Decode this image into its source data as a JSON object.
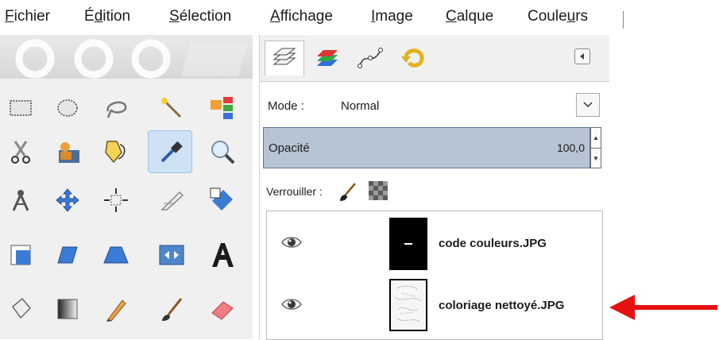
{
  "menubar": {
    "items": [
      {
        "before": "",
        "u": "F",
        "after": "ichier"
      },
      {
        "before": "É",
        "u": "d",
        "after": "ition"
      },
      {
        "before": "",
        "u": "S",
        "after": "élection"
      },
      {
        "before": "",
        "u": "A",
        "after": "ffichage"
      },
      {
        "before": "",
        "u": "I",
        "after": "mage"
      },
      {
        "before": "",
        "u": "C",
        "after": "alque"
      },
      {
        "before": "Coule",
        "u": "u",
        "after": "rs"
      }
    ]
  },
  "layers_dock": {
    "mode_label": "Mode :",
    "mode_value": "Normal",
    "opacity_label": "Opacité",
    "opacity_value": "100,0",
    "lock_label": "Verrouiller :",
    "layers": [
      {
        "name": "code couleurs.JPG"
      },
      {
        "name": "coloriage nettoyé.JPG"
      }
    ]
  },
  "colors": {
    "opacity_fill": "#b7c4d4",
    "selection_blue": "#cfe1f5",
    "annotation_red": "#e61010"
  }
}
